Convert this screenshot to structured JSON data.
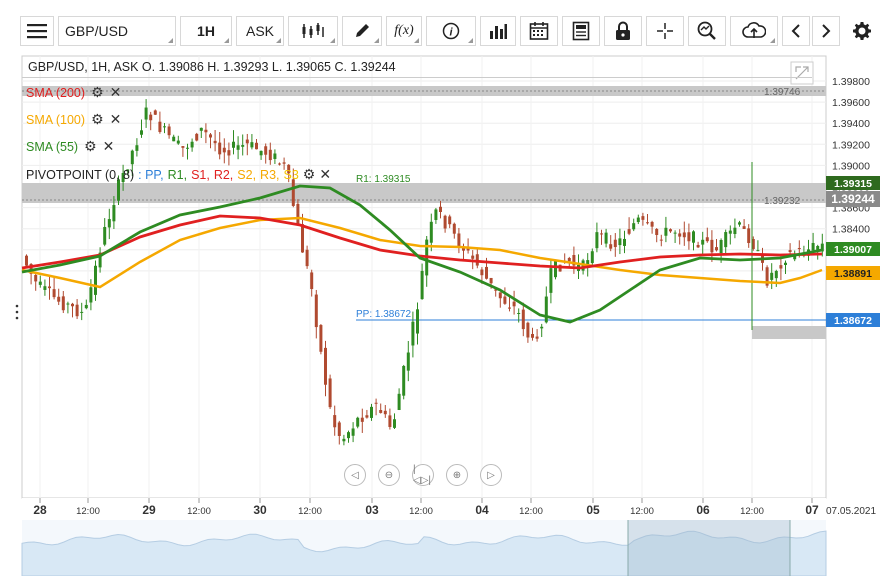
{
  "toolbar": {
    "menu_icon": "hamburger-icon",
    "symbol": "GBP/USD",
    "timeframe": "1H",
    "price_type": "ASK",
    "tools": [
      "candles-icon",
      "draw-pencil-icon",
      "fx-icon",
      "info-icon",
      "bar-chart-icon",
      "calendar-icon",
      "news-icon",
      "lock-icon",
      "crosshair-icon",
      "zoom-icon",
      "cloud-upload-icon",
      "prev-icon",
      "next-icon",
      "gear-icon"
    ],
    "fx_label": "f(x)"
  },
  "info_line": "GBP/USD, 1H, ASK   O. 1.39086 H. 1.39293 L. 1.39065 C. 1.39244",
  "indicators": {
    "sma200": "SMA (200)",
    "sma100": "SMA (100)",
    "sma55": "SMA (55)",
    "pivot_prefix": "PIVOTPOINT (0, 8)",
    "pivot_items": [
      ": PP,",
      "R1,",
      "S1,",
      "R2,",
      "S2,",
      "R3,",
      "S3"
    ]
  },
  "colors": {
    "sma200": "#e02020",
    "sma100": "#f5a800",
    "sma55": "#2e8b22",
    "pp": "#2d7fd8",
    "r1": "#2e8b22",
    "s1": "#e02020",
    "candle_up": "#2e8b22",
    "candle_down": "#b04a30"
  },
  "price_axis": [
    "1.39800",
    "1.39600",
    "1.39400",
    "1.39200",
    "1.39000",
    "1.38800",
    "1.38600",
    "1.38400",
    "1.38200",
    "1.38000"
  ],
  "price_tags": {
    "r1": "1.39315",
    "current": "1.39244",
    "sma55": "1.39007",
    "sma100": "1.38891",
    "pp": "1.38672"
  },
  "chart_labels": {
    "top_line": "1.39746",
    "mid_line": "1.39232",
    "r1_label": "R1: 1.39315",
    "pp_label": "PP: 1.38672"
  },
  "time_axis": [
    "28",
    "12:00",
    "29",
    "12:00",
    "30",
    "12:00",
    "03",
    "12:00",
    "04",
    "12:00",
    "05",
    "12:00",
    "06",
    "12:00",
    "07",
    "07.05.2021"
  ]
}
